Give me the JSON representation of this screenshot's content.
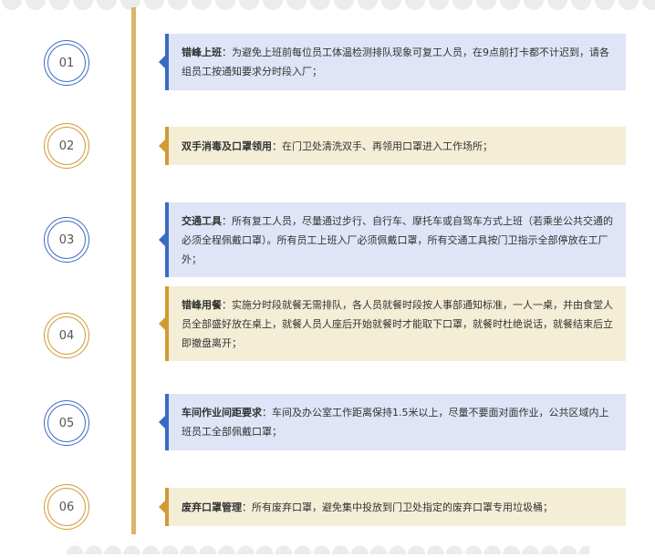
{
  "steps": [
    {
      "number": "01",
      "color": "blue",
      "term": "错峰上班",
      "desc": "：为避免上班前每位员工体温检测排队现象可复工人员，在9点前打卡都不计迟到，请各组员工按通知要求分时段入厂；"
    },
    {
      "number": "02",
      "color": "gold",
      "term": "双手消毒及口罩领用",
      "desc": "：在门卫处清洗双手、再领用口罩进入工作场所；"
    },
    {
      "number": "03",
      "color": "blue",
      "term": "交通工具",
      "desc": "：所有复工人员，尽量通过步行、自行车、摩托车或自驾车方式上班（若乘坐公共交通的必须全程佩戴口罩）。所有员工上班入厂必须佩戴口罩，所有交通工具按门卫指示全部停放在工厂外；"
    },
    {
      "number": "04",
      "color": "gold",
      "term": "错峰用餐",
      "desc": "：实施分时段就餐无需排队，各人员就餐时段按人事部通知标准，一人一桌，并由食堂人员全部盛好放在桌上，就餐人员人座后开始就餐时才能取下口罩，就餐时杜绝说话，就餐结束后立即撤盘离开；"
    },
    {
      "number": "05",
      "color": "blue",
      "term": "车间作业间距要求",
      "desc": "：车间及办公室工作距离保持1.5米以上，尽量不要面对面作业，公共区域内上班员工全部佩戴口罩；"
    },
    {
      "number": "06",
      "color": "gold",
      "term": "废弃口罩管理",
      "desc": "：所有废弃口罩，避免集中投放到门卫处指定的废弃口罩专用垃圾桶；"
    }
  ],
  "colors": {
    "blue_accent": "#3a6bc4",
    "blue_card": "#dfe5f7",
    "gold_accent": "#d19a34",
    "gold_card": "#f4eed7",
    "timeline": "#d9b46a"
  }
}
